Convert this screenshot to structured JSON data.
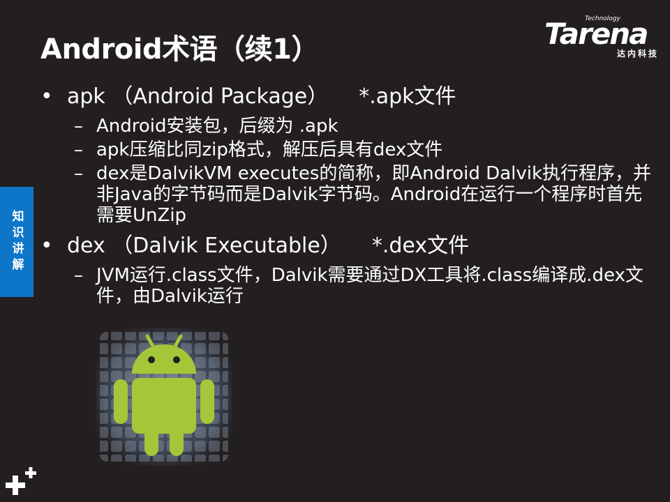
{
  "slide": {
    "title": "Android术语（续1）",
    "logo": {
      "tagline": "Technology",
      "wordmark": "Tarena",
      "chinese": "达内科技"
    },
    "side_tab": "知识讲解",
    "bullets": [
      {
        "main": "apk （Android Package）",
        "ext": "*.apk文件",
        "subs": [
          "Android安装包，后缀为 .apk",
          "apk压缩比同zip格式，解压后具有dex文件",
          "dex是DalvikVM executes的简称，即Android Dalvik执行程序，并非Java的字节码而是Dalvik字节码。Android在运行一个程序时首先需要UnZip"
        ]
      },
      {
        "main": "dex （Dalvik Executable）",
        "ext": "*.dex文件",
        "subs": [
          "JVM运行.class文件，Dalvik需要通过DX工具将.class编译成.dex文件，由Dalvik运行"
        ]
      }
    ],
    "bullet_glyph": "•",
    "dash_glyph": "–",
    "image_icon": "android-robot-icon",
    "corner_icon": "plus-icon",
    "colors": {
      "background": "#231f20",
      "text": "#ffffff",
      "side_tab": "#0d76c8",
      "android_green": "#a4c639"
    }
  }
}
